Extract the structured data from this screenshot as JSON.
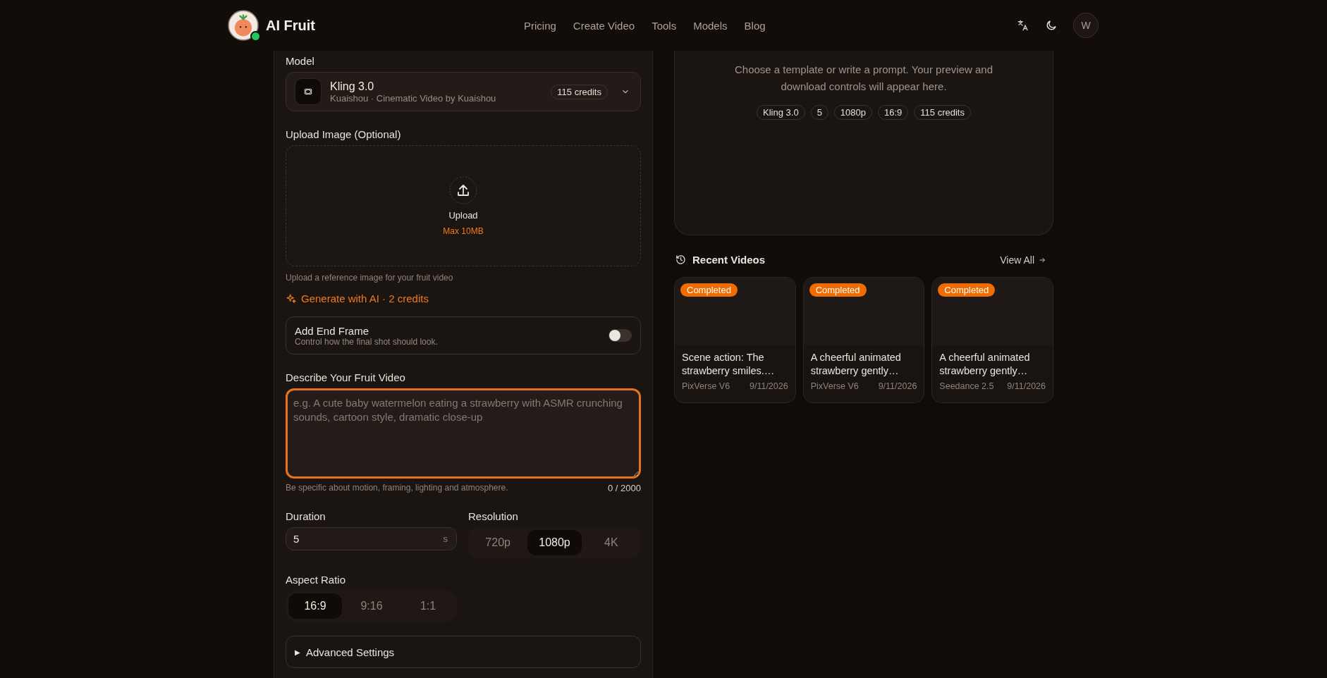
{
  "header": {
    "brand": "AI Fruit",
    "nav": [
      {
        "label": "Pricing"
      },
      {
        "label": "Create Video"
      },
      {
        "label": "Tools"
      },
      {
        "label": "Models"
      },
      {
        "label": "Blog"
      }
    ],
    "avatar": "W",
    "online": true
  },
  "form": {
    "model": {
      "label": "Model",
      "name": "Kling 3.0",
      "subtitle": "Kuaishou · Cinematic Video by Kuaishou",
      "credits": "115 credits"
    },
    "upload": {
      "label": "Upload Image (Optional)",
      "button": "Upload",
      "limit": "Max 10MB",
      "hint": "Upload a reference image for your fruit video"
    },
    "generate_link": "Generate with AI · 2 credits",
    "end_frame": {
      "title": "Add End Frame",
      "subtitle": "Control how the final shot should look.",
      "on": false
    },
    "prompt": {
      "label": "Describe Your Fruit Video",
      "placeholder": "e.g. A cute baby watermelon eating a strawberry with ASMR crunching sounds, cartoon style, dramatic close-up",
      "hint": "Be specific about motion, framing, lighting and atmosphere.",
      "counter": "0 / 2000"
    },
    "duration": {
      "label": "Duration",
      "value": "5",
      "unit": "s"
    },
    "resolution": {
      "label": "Resolution",
      "options": [
        {
          "label": "720p",
          "selected": false
        },
        {
          "label": "1080p",
          "selected": true
        },
        {
          "label": "4K",
          "selected": false
        }
      ]
    },
    "aspect_ratio": {
      "label": "Aspect Ratio",
      "options": [
        {
          "label": "16:9",
          "selected": true
        },
        {
          "label": "9:16",
          "selected": false
        },
        {
          "label": "1:1",
          "selected": false
        }
      ]
    },
    "advanced": {
      "marker": "▶",
      "label": "Advanced Settings",
      "expanded": false
    }
  },
  "preview": {
    "description": "Choose a template or write a prompt. Your preview and download controls will appear here.",
    "chips": [
      "Kling 3.0",
      "5",
      "1080p",
      "16:9",
      "115 credits"
    ]
  },
  "recent": {
    "title": "Recent Videos",
    "view_all": "View All",
    "videos": [
      {
        "status": "Completed",
        "title": "Scene action: The strawberry smiles.…",
        "model": "PixVerse V6",
        "date": "9/11/2026"
      },
      {
        "status": "Completed",
        "title": "A cheerful animated strawberry gently…",
        "model": "PixVerse V6",
        "date": "9/11/2026"
      },
      {
        "status": "Completed",
        "title": "A cheerful animated strawberry gently…",
        "model": "Seedance 2.5",
        "date": "9/11/2026"
      }
    ]
  }
}
